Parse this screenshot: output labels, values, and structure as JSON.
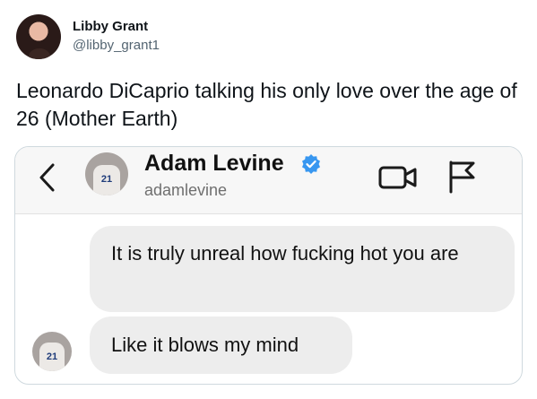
{
  "tweet": {
    "display_name": "Libby Grant",
    "handle": "@libby_grant1",
    "text": "Leonardo DiCaprio talking his only love over the age of 26 (Mother Earth)"
  },
  "screenshot": {
    "header": {
      "contact_name": "Adam Levine",
      "contact_username": "adamlevine",
      "jersey_number": "21",
      "icons": {
        "back": "chevron-left-icon",
        "verified": "verified-badge-icon",
        "video": "video-call-icon",
        "report": "flag-icon"
      },
      "verified_color": "#3897f0"
    },
    "messages": [
      {
        "text": "It is truly unreal how fucking hot you are"
      },
      {
        "text": "Like it blows my mind"
      }
    ],
    "bubble_color": "#ededed"
  }
}
